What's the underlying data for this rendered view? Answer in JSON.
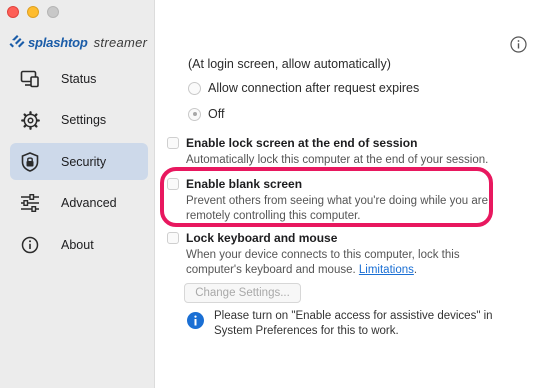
{
  "app": {
    "brand_name": "splashtop",
    "brand_sub": "streamer"
  },
  "sidebar": {
    "items": [
      {
        "label": "Status",
        "icon": "status-icon",
        "active": false
      },
      {
        "label": "Settings",
        "icon": "gear-icon",
        "active": false
      },
      {
        "label": "Security",
        "icon": "lock-shield-icon",
        "active": true
      },
      {
        "label": "Advanced",
        "icon": "sliders-icon",
        "active": false
      },
      {
        "label": "About",
        "icon": "info-circle-icon",
        "active": false
      }
    ]
  },
  "security": {
    "login_screen_note": "(At login screen, allow automatically)",
    "radio_allow_label": "Allow connection after request expires",
    "radio_off_label": "Off",
    "radio_selected": "Off",
    "lock_screen": {
      "title": "Enable lock screen at the end of session",
      "desc": "Automatically lock this computer at the end of your session.",
      "checked": false
    },
    "blank_screen": {
      "title": "Enable blank screen",
      "desc": "Prevent others from seeing what you're doing while you are remotely controlling this computer.",
      "checked": false,
      "highlighted": true
    },
    "lock_keyboard": {
      "title": "Lock keyboard and mouse",
      "desc": "When your device connects to this computer, lock this computer's keyboard and mouse.",
      "link": "Limitations",
      "link_suffix": ".",
      "checked": false
    },
    "change_settings_label": "Change Settings...",
    "notice_text": "Please turn on \"Enable access for assistive devices\" in System Preferences for this to work."
  },
  "colors": {
    "accent": "#1a6fd4",
    "brand": "#1a5ca8",
    "highlight": "#e8185f",
    "active_nav": "#cdd9ea"
  }
}
